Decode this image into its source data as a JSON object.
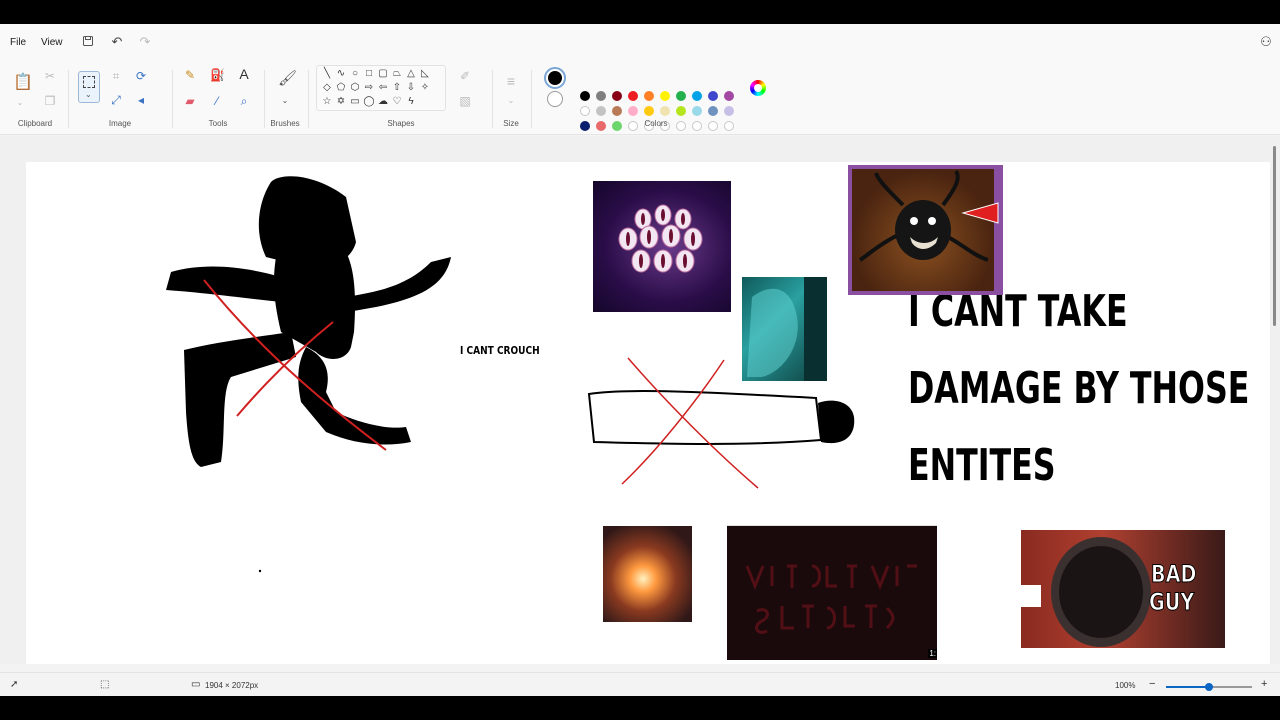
{
  "menu": {
    "file": "File",
    "view": "View"
  },
  "ribbon": {
    "groups": {
      "clipboard": "Clipboard",
      "image": "Image",
      "tools": "Tools",
      "brushes": "Brushes",
      "shapes": "Shapes",
      "size": "Size",
      "colors": "Colors"
    },
    "primary_color": "#000000",
    "secondary_color": "#ffffff",
    "palette_row1": [
      "#000000",
      "#7f7f7f",
      "#880015",
      "#ed1c24",
      "#ff7f27",
      "#fff200",
      "#22b14c",
      "#00a2e8",
      "#3f48cc",
      "#a349a4"
    ],
    "palette_row2": [
      "#ffffff",
      "#c3c3c3",
      "#b97a57",
      "#ffaec9",
      "#ffc90e",
      "#efe4b0",
      "#b5e61d",
      "#99d9ea",
      "#7092be",
      "#c8bfe7"
    ],
    "palette_row3": [
      "#0a1f6e",
      "#e86a6a",
      "#6bd66b",
      "",
      "",
      "",
      "",
      "",
      "",
      ""
    ]
  },
  "canvas": {
    "crouch_text": "I CANT CROUCH",
    "damage_line1": "I CANT TAKE",
    "damage_line2": "DAMAGE BY THOSE",
    "damage_line3": "ENTITES",
    "thumb_badge_text": "BAD",
    "thumb_badge_text2": "GUY",
    "video_time": "1:"
  },
  "status": {
    "canvas_size": "1904 × 2072px",
    "zoom": "100%",
    "zoom_level": 0.5
  }
}
